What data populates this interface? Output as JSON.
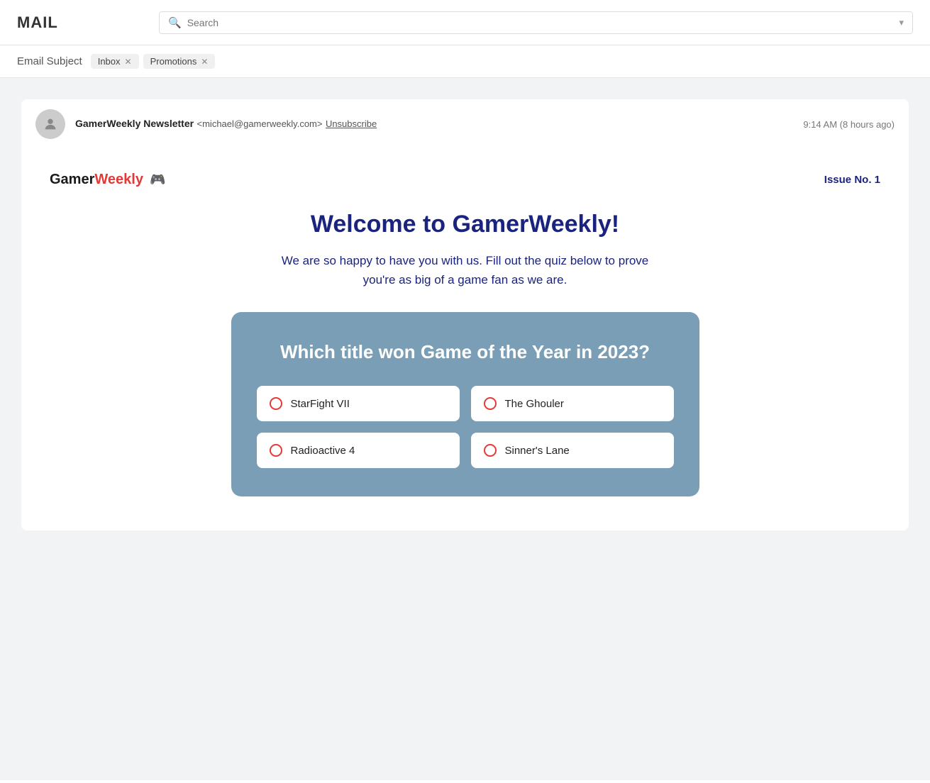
{
  "header": {
    "logo": "MAIL",
    "search": {
      "placeholder": "Search"
    }
  },
  "email_subject_bar": {
    "subject_label": "Email Subject",
    "tabs": [
      {
        "label": "Inbox",
        "id": "inbox"
      },
      {
        "label": "Promotions",
        "id": "promotions"
      }
    ]
  },
  "sender": {
    "name": "GamerWeekly Newsletter",
    "email": "<michael@gamerweekly.com>",
    "unsubscribe_text": "Unsubscribe",
    "timestamp": "9:14 AM (8 hours ago)"
  },
  "newsletter": {
    "brand_black": "Gamer",
    "brand_red": "Weekly",
    "brand_icon": "🎮",
    "issue_label": "Issue No. 1",
    "welcome_title": "Welcome to GamerWeekly!",
    "welcome_body": "We are so happy to have you with us. Fill out the quiz below to prove you're as big of a game fan as we are.",
    "quiz": {
      "question": "Which title won Game of the Year in 2023?",
      "options": [
        {
          "id": "a",
          "label": "StarFight VII"
        },
        {
          "id": "b",
          "label": "The Ghouler"
        },
        {
          "id": "c",
          "label": "Radioactive 4"
        },
        {
          "id": "d",
          "label": "Sinner's Lane"
        }
      ]
    }
  },
  "colors": {
    "brand_red": "#e53935",
    "dark_navy": "#1a237e",
    "quiz_bg": "#7a9eb5"
  }
}
